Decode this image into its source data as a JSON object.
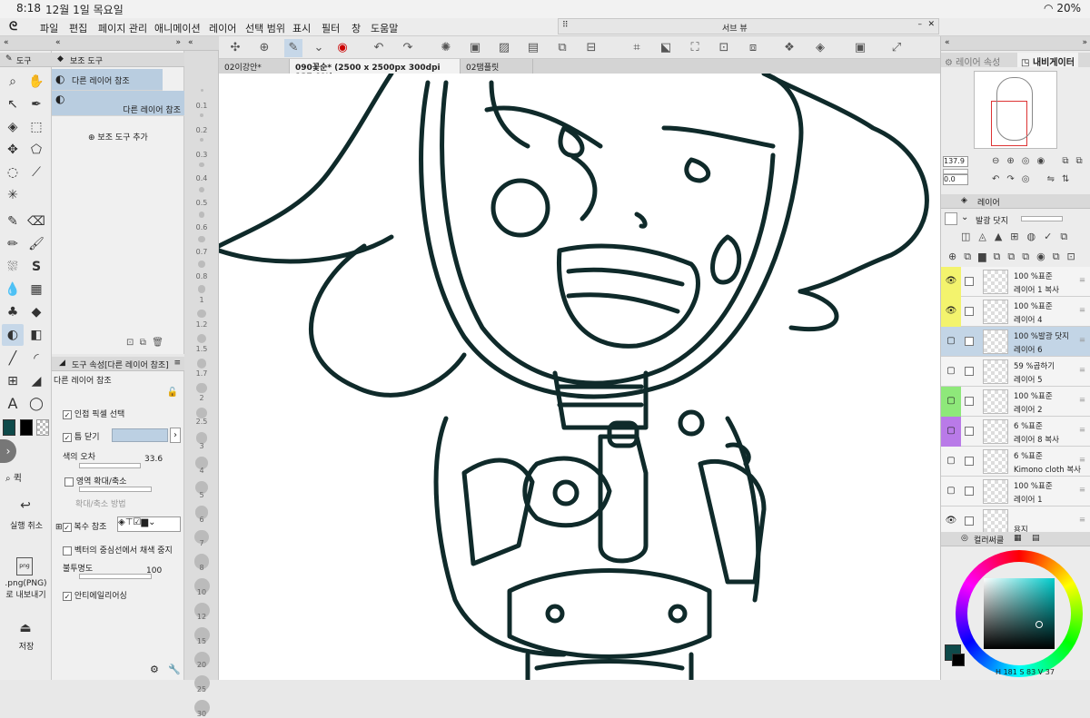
{
  "status": {
    "time": "8:18",
    "date": "12월 1일 목요일",
    "battery": "20%"
  },
  "menu": [
    "파일",
    "편집",
    "페이지 관리",
    "애니메이션",
    "레이어",
    "선택 범위",
    "표시",
    "필터",
    "창",
    "도움말"
  ],
  "subview": {
    "title": "서브 뷰"
  },
  "tool_panel": {
    "header": "도구"
  },
  "subtool": {
    "header": "보조 도구",
    "items": [
      {
        "label": "다른 레이어 참조"
      },
      {
        "label": "다른 레이어 참조"
      }
    ],
    "add_label": "보조 도구 추가"
  },
  "tool_property": {
    "header": "도구 속성[다른 레이어 참조]",
    "name": "다른 레이어 참조",
    "adjacent_pixel": "인접 픽셀 선택",
    "close_gap": "틈 닫기",
    "tolerance_label": "색의 오차",
    "tolerance_value": "33.6",
    "area_scaling": "영역 확대/축소",
    "scaling_method": "확대/축소 방법",
    "multi_ref": "복수 참조",
    "vector_stop": "벡터의 중심선에서 채색 중지",
    "opacity_label": "불투명도",
    "opacity_value": "100",
    "antialias": "안티에일리어싱"
  },
  "left_actions": {
    "undo": "실행 취소",
    "export": ".png(PNG)\n로 내보내기",
    "save": "저장",
    "quick": "퀵"
  },
  "ruler_ticks": [
    "0.1",
    "0.2",
    "0.3",
    "0.4",
    "0.5",
    "0.6",
    "0.7",
    "0.8",
    "1",
    "1.2",
    "1.5",
    "1.7",
    "2",
    "2.5",
    "3",
    "4",
    "5",
    "6",
    "7",
    "8",
    "10",
    "12",
    "15",
    "20",
    "25",
    "30"
  ],
  "tabs": [
    {
      "label": "02이강안*"
    },
    {
      "label": "090꽃순* (2500 x 2500px 300dpi 137.9%)"
    },
    {
      "label": "02탬플릿"
    }
  ],
  "navigator": {
    "tab_prop": "레이어 속성",
    "tab_nav": "내비게이터",
    "zoom": "137.9",
    "rotation": "0.0"
  },
  "layer_panel": {
    "header": "레이어",
    "blend": "발광 닷지",
    "layers": [
      {
        "mode": "100 %표준",
        "name": "레이어 1 복사",
        "color": "#f3f36d",
        "visible": true
      },
      {
        "mode": "100 %표준",
        "name": "레이어 4",
        "color": "#f3f36d",
        "visible": true
      },
      {
        "mode": "100 %발광 닷지",
        "name": "레이어 6",
        "color": "",
        "visible": false
      },
      {
        "mode": "59 %곱하기",
        "name": "레이어 5",
        "color": "",
        "visible": false
      },
      {
        "mode": "100 %표준",
        "name": "레이어 2",
        "color": "#8ee87a",
        "visible": false
      },
      {
        "mode": "6 %표준",
        "name": "레이어 8 복사",
        "color": "#b97ae8",
        "visible": false
      },
      {
        "mode": "6 %표준",
        "name": "Kimono cloth 복사",
        "color": "",
        "visible": false
      },
      {
        "mode": "100 %표준",
        "name": "레이어 1",
        "color": "",
        "visible": false
      },
      {
        "mode": "",
        "name": "용지",
        "color": "",
        "visible": true
      }
    ]
  },
  "color_panel": {
    "header": "컬러써클",
    "h": "181",
    "s": "83",
    "v": "37",
    "main_color": "#0e4a4a"
  }
}
